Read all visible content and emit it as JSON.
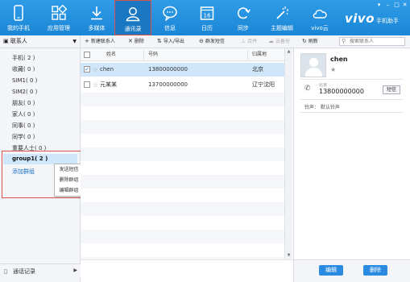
{
  "nav": {
    "items": [
      {
        "label": "我的手机",
        "icon": "phone-icon"
      },
      {
        "label": "应用管理",
        "icon": "apps-grid-icon"
      },
      {
        "label": "多媒体",
        "icon": "download-icon"
      },
      {
        "label": "通讯录",
        "icon": "contact-person-icon"
      },
      {
        "label": "信息",
        "icon": "message-bubble-icon"
      },
      {
        "label": "日历",
        "icon": "calendar-icon"
      },
      {
        "label": "同步",
        "icon": "sync-icon"
      },
      {
        "label": "主题编辑",
        "icon": "magic-wand-icon"
      },
      {
        "label": "vivo云",
        "icon": "cloud-icon"
      }
    ],
    "active": "通讯录",
    "calendar_day": "16",
    "brand": "vivo",
    "brand_sub": "手机助手",
    "colors": {
      "nav_bg": "#1a86d6",
      "active_border": "#d9534f"
    }
  },
  "sidebar": {
    "header": "联系人",
    "groups": [
      "手机( 2 )",
      "收藏( 0 )",
      "SIM1( 0 )",
      "SIM2( 0 )",
      "朋友( 0 )",
      "家人( 0 )",
      "同事( 0 )",
      "同学( 0 )",
      "重要人士( 0 )",
      "group1( 2 )"
    ],
    "selected_group": "group1( 2 )",
    "add_group": "添加群组",
    "context_menu": [
      "发送短信",
      "删除群组",
      "编辑群组"
    ],
    "call_log": "通话记录"
  },
  "toolbar": {
    "new_contact": "新建联系人",
    "delete": "删除",
    "import_export": "导入/导出",
    "group_sms": "群发短信",
    "merge": "合并",
    "save_to_phone": "云备份",
    "refresh": "刷新",
    "search_placeholder": "搜索联系人"
  },
  "table": {
    "columns": [
      "姓名",
      "号码",
      "归属地"
    ],
    "rows": [
      {
        "name": "chen",
        "number": "13800000000",
        "location": "北京",
        "checked": true
      },
      {
        "name": "元某某",
        "number": "13700000000",
        "location": "辽宁沈阳",
        "checked": false
      }
    ]
  },
  "detail": {
    "name": "chen",
    "location": "北京",
    "number": "13800000000",
    "sms_button": "短信",
    "ringtone": "铃声：  默认铃声",
    "edit_button": "编辑",
    "delete_button": "删除"
  }
}
